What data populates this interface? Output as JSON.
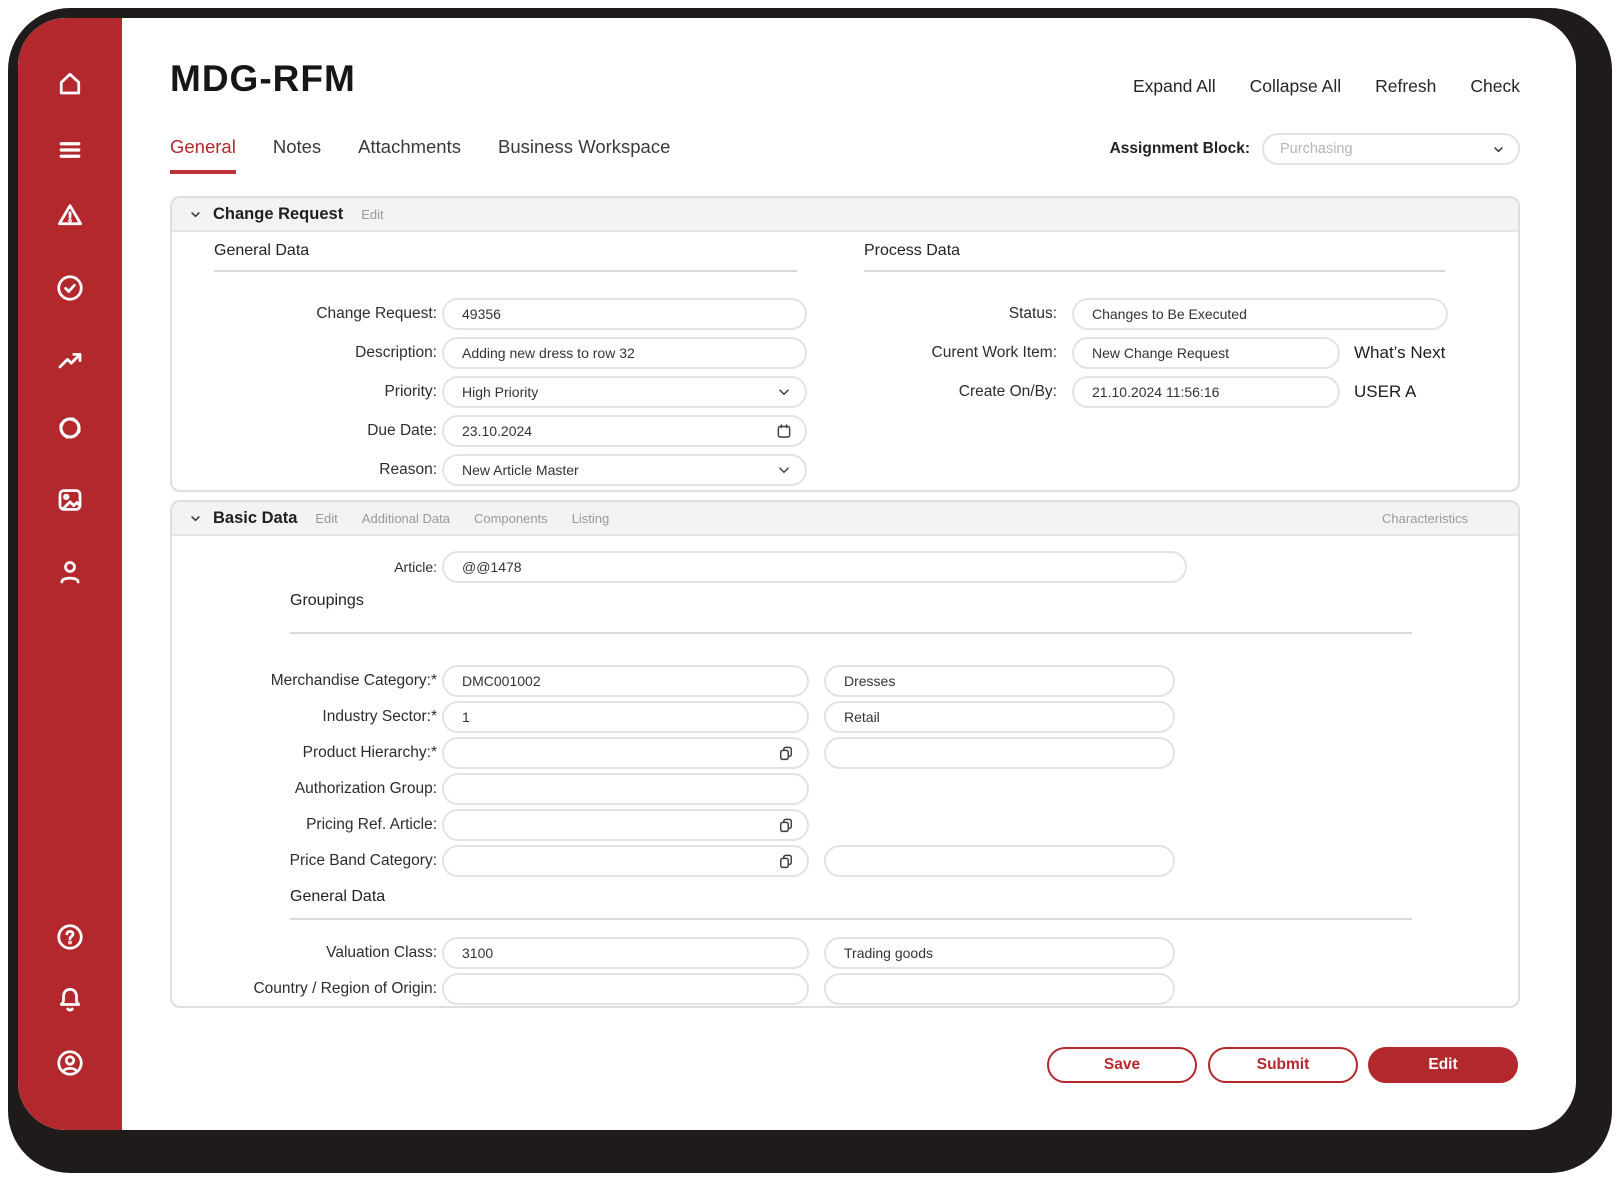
{
  "app_title": "MDG-RFM",
  "header_actions": {
    "expand": "Expand All",
    "collapse": "Collapse All",
    "refresh": "Refresh",
    "check": "Check"
  },
  "tabs": {
    "general": "General",
    "notes": "Notes",
    "attachments": "Attachments",
    "workspace": "Business Workspace"
  },
  "assignment_block": {
    "label": "Assignment Block:",
    "placeholder": "Purchasing"
  },
  "change_request": {
    "title": "Change Request",
    "edit_link": "Edit",
    "left_header": "General Data",
    "right_header": "Process Data",
    "change_request": {
      "label": "Change Request:",
      "value": "49356"
    },
    "description": {
      "label": "Description:",
      "value": "Adding new dress to row 32"
    },
    "priority": {
      "label": "Priority:",
      "value": "High Priority"
    },
    "due_date": {
      "label": "Due Date:",
      "value": "23.10.2024"
    },
    "reason": {
      "label": "Reason:",
      "value": "New Article Master"
    },
    "status": {
      "label": "Status:",
      "value": "Changes to Be Executed"
    },
    "current_work_item": {
      "label": "Curent Work Item:",
      "value": "New Change Request",
      "annotation": "What’s Next"
    },
    "create_on_by": {
      "label": "Create On/By:",
      "value": "21.10.2024 11:56:16",
      "annotation": "USER A"
    }
  },
  "basic_data": {
    "title": "Basic Data",
    "links": {
      "edit": "Edit",
      "additional": "Additional Data",
      "components": "Components",
      "listing": "Listing"
    },
    "right_link": "Characteristics",
    "article": {
      "label": "Article:",
      "value": "@@1478"
    },
    "groupings_header": "Groupings",
    "general_header": "General Data",
    "rows": [
      {
        "label": "Merchandise Category:*",
        "value": "DMC001002",
        "value2": "Dresses"
      },
      {
        "label": "Industry Sector:*",
        "value": "1",
        "value2": "Retail"
      },
      {
        "label": "Product Hierarchy:*",
        "value": "",
        "value2": ""
      },
      {
        "label": "Authorization Group:",
        "value": ""
      },
      {
        "label": "Pricing Ref. Article:",
        "value": ""
      },
      {
        "label": "Price Band Category:",
        "value": "",
        "value2": ""
      }
    ],
    "general_rows": [
      {
        "label": "Valuation Class:",
        "value": "3100",
        "value2": "Trading goods"
      },
      {
        "label": "Country / Region of Origin:",
        "value": "",
        "value2": ""
      }
    ]
  },
  "footer": {
    "save": "Save",
    "submit": "Submit",
    "edit": "Edit"
  },
  "colors": {
    "accent": "#b3282d",
    "frame": "#201b1b",
    "panel_header": "#f3f3f3",
    "field_border": "#e3e3e3"
  }
}
